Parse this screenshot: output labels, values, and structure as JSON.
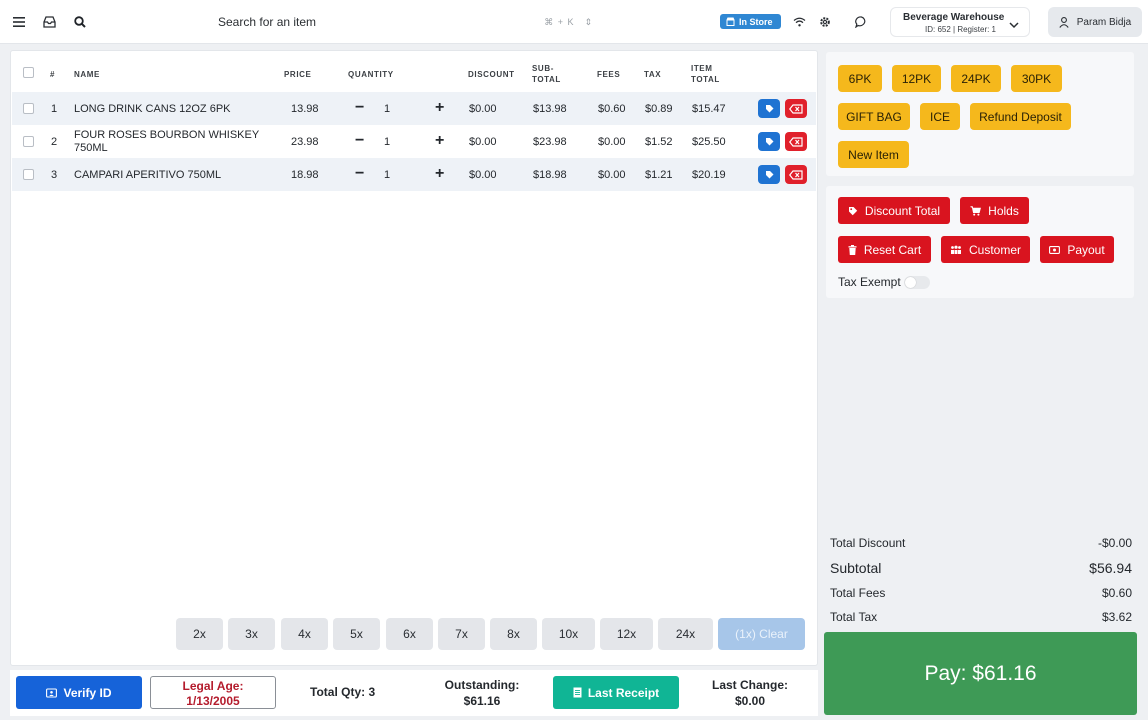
{
  "topbar": {
    "search_placeholder": "Search for an item",
    "search_shortcut": "⌘ + K",
    "instore_label": "In Store",
    "store_name": "Beverage Warehouse",
    "store_info": "ID: 652 | Register: 1",
    "user_name": "Param Bidja"
  },
  "cart": {
    "headers": {
      "num": "#",
      "name": "NAME",
      "price": "PRICE",
      "quantity": "QUANTITY",
      "discount": "DISCOUNT",
      "subtotal_1": "SUB-",
      "subtotal_2": "TOTAL",
      "fees": "FEES",
      "tax": "TAX",
      "item_total_1": "ITEM",
      "item_total_2": "TOTAL"
    },
    "rows": [
      {
        "num": "1",
        "name": "LONG DRINK CANS 12OZ 6PK",
        "name2": "",
        "price": "13.98",
        "qty": "1",
        "discount": "$0.00",
        "subtotal": "$13.98",
        "fees": "$0.60",
        "tax": "$0.89",
        "total": "$15.47"
      },
      {
        "num": "2",
        "name": "FOUR ROSES BOURBON WHISKEY",
        "name2": "750ML",
        "price": "23.98",
        "qty": "1",
        "discount": "$0.00",
        "subtotal": "$23.98",
        "fees": "$0.00",
        "tax": "$1.52",
        "total": "$25.50"
      },
      {
        "num": "3",
        "name": "CAMPARI APERITIVO 750ML",
        "name2": "",
        "price": "18.98",
        "qty": "1",
        "discount": "$0.00",
        "subtotal": "$18.98",
        "fees": "$0.00",
        "tax": "$1.21",
        "total": "$20.19"
      }
    ],
    "multipliers": [
      "2x",
      "3x",
      "4x",
      "5x",
      "6x",
      "7x",
      "8x",
      "10x",
      "12x",
      "24x"
    ],
    "clear_label": "(1x) Clear"
  },
  "bottombar": {
    "verify_label": "Verify ID",
    "legal_label": "Legal Age:",
    "legal_date": "1/13/2005",
    "total_qty": "Total Qty: 3",
    "outstanding_label": "Outstanding:",
    "outstanding_value": "$61.16",
    "last_receipt_label": "Last Receipt",
    "last_change_label": "Last Change:",
    "last_change_value": "$0.00"
  },
  "quick_buttons": [
    "6PK",
    "12PK",
    "24PK",
    "30PK",
    "GIFT BAG",
    "ICE",
    "Refund Deposit",
    "New Item"
  ],
  "actions": {
    "discount_total": "Discount Total",
    "holds": "Holds",
    "reset_cart": "Reset Cart",
    "customer": "Customer",
    "payout": "Payout",
    "tax_exempt": "Tax Exempt"
  },
  "totals": {
    "discount_label": "Total Discount",
    "discount_value": "-$0.00",
    "subtotal_label": "Subtotal",
    "subtotal_value": "$56.94",
    "fees_label": "Total Fees",
    "fees_value": "$0.60",
    "tax_label": "Total Tax",
    "tax_value": "$3.62"
  },
  "pay_label": "Pay: $61.16",
  "colors": {
    "quick_button": "#f5b81c",
    "action_button": "#d9141f",
    "pay_button": "#3e9a56",
    "verify_button": "#1663d9",
    "receipt_button": "#10b595",
    "instore_badge": "#2f87d3"
  }
}
